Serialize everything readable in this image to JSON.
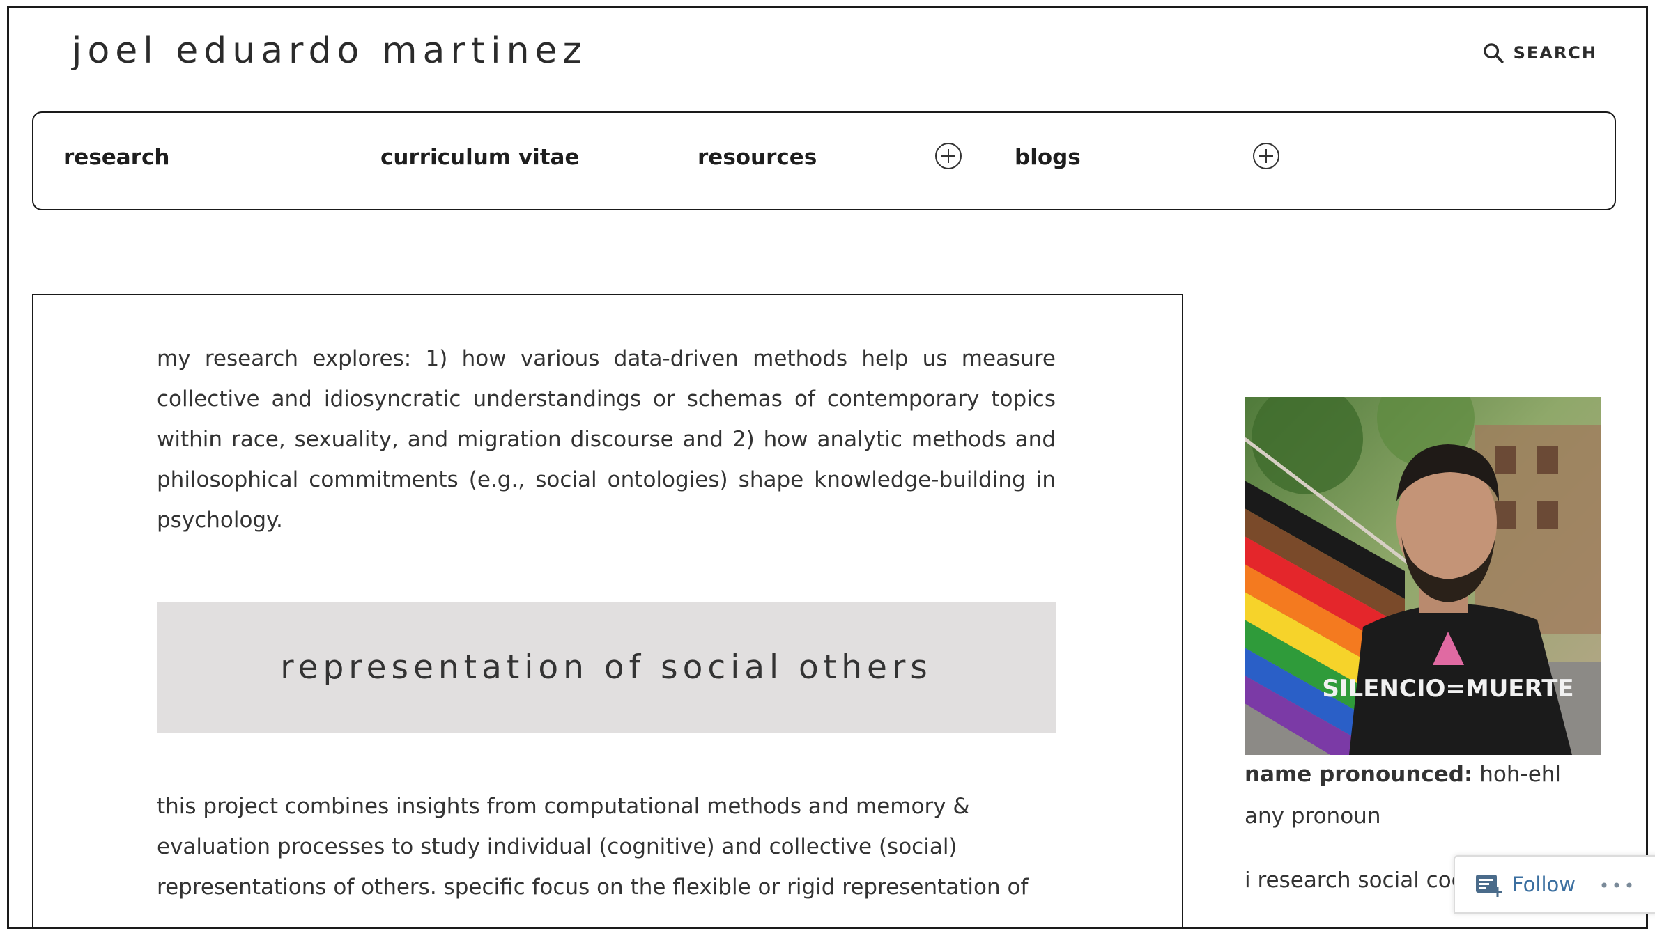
{
  "site": {
    "title": "joel eduardo martinez"
  },
  "search": {
    "label": "SEARCH"
  },
  "nav": {
    "items": [
      {
        "label": "research"
      },
      {
        "label": "curriculum vitae"
      },
      {
        "label": "resources"
      },
      {
        "label": "blogs"
      }
    ]
  },
  "main": {
    "intro": "my research explores: 1) how various data-driven methods help us measure collective and idiosyncratic understandings or schemas of contemporary topics within race, sexuality, and migration discourse and 2) how analytic methods and philosophical commitments (e.g., social ontologies) shape knowledge-building in psychology.",
    "section_heading": "representation of social others",
    "project_text_lines": [
      "this project combines insights from computational methods and memory &",
      "evaluation processes to study individual (cognitive) and collective (social)",
      "representations of others. specific focus on the flexible or rigid representation of"
    ]
  },
  "sidebar": {
    "photo_shirt_text": "SILENCIO=MUERTE",
    "pronounced_label": "name pronounced:",
    "pronounced_value": " hoh-ehl",
    "pronoun": "any pronoun",
    "bio_start": "i research social cog"
  },
  "follow": {
    "label": "Follow",
    "more": "•••"
  },
  "colors": {
    "banner_bg": "#e1dfdf",
    "text": "#333333",
    "follow_text": "#3b6fa0"
  }
}
